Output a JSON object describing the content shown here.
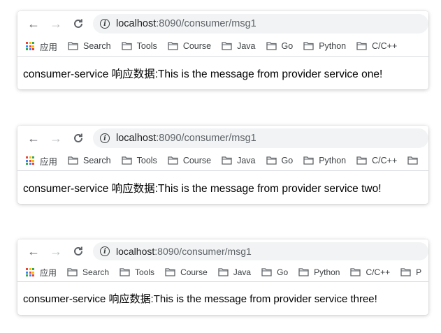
{
  "windows": [
    {
      "url_host": "localhost",
      "url_rest": ":8090/consumer/msg1",
      "bookmarks": [
        "应用",
        "Search",
        "Tools",
        "Course",
        "Java",
        "Go",
        "Python",
        "C/C++"
      ],
      "message": "consumer-service 响应数据:This is the message from provider service one!"
    },
    {
      "url_host": "localhost",
      "url_rest": ":8090/consumer/msg1",
      "bookmarks": [
        "应用",
        "Search",
        "Tools",
        "Course",
        "Java",
        "Go",
        "Python",
        "C/C++"
      ],
      "message": "consumer-service 响应数据:This is the message from provider service two!"
    },
    {
      "url_host": "localhost",
      "url_rest": ":8090/consumer/msg1",
      "bookmarks": [
        "应用",
        "Search",
        "Tools",
        "Course",
        "Java",
        "Go",
        "Python",
        "C/C++",
        "P"
      ],
      "message": "consumer-service 响应数据:This is the message from provider service three!"
    }
  ],
  "icons": {
    "back": "arrow-left-icon",
    "forward": "arrow-right-icon",
    "reload": "reload-icon",
    "info": "info-icon",
    "apps": "apps-grid-icon",
    "folder": "folder-icon"
  },
  "colors": {
    "apps_grid": [
      "#ea4335",
      "#fbbc04",
      "#34a853",
      "#4285f4",
      "#ea4335",
      "#fbbc04",
      "#34a853",
      "#4285f4",
      "#ea4335"
    ],
    "omnibox_bg": "#f1f3f4",
    "separator": "#dadce0"
  }
}
